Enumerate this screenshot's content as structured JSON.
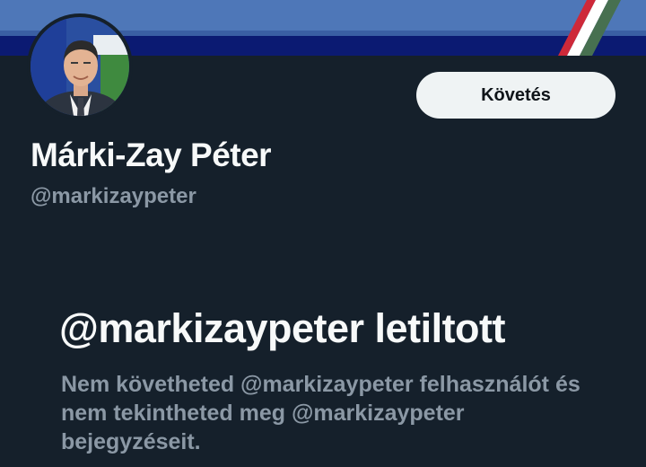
{
  "profile": {
    "display_name": "Márki-Zay Péter",
    "handle": "@markizaypeter",
    "follow_label": "Követés"
  },
  "blocked": {
    "title": "@markizaypeter letiltott",
    "message": "Nem követheted @markizaypeter felhasználót és nem tekintheted meg @markizaypeter bejegyzéseit."
  },
  "colors": {
    "background": "#15202b",
    "banner_blue": "#4e77b8",
    "banner_navy": "#0b1a72",
    "text_primary": "#f7f9f9",
    "text_secondary": "#8b98a5",
    "button_bg": "#eff3f4",
    "flag_red": "#ce2939",
    "flag_white": "#ffffff",
    "flag_green": "#477050"
  }
}
